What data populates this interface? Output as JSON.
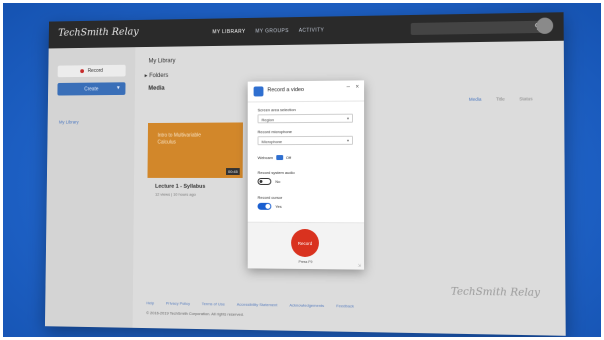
{
  "app": {
    "brand": "TechSmith Relay",
    "nav_tabs": [
      "MY LIBRARY",
      "MY GROUPS",
      "ACTIVITY"
    ],
    "search_icon": "search-icon",
    "colors": {
      "accent": "#3a6fb8",
      "record": "#d9321f",
      "thumbnail": "#d2872a",
      "topbar": "#2a2a2a"
    }
  },
  "sidebar": {
    "record_label": "Record",
    "create_label": "Create",
    "link_label": "My Library"
  },
  "main": {
    "breadcrumb": "My Library",
    "folders_label": "Folders",
    "media_label": "Media",
    "view_tabs": [
      "Media",
      "Title",
      "Status"
    ],
    "card": {
      "thumb_text": "Intro to Multivariable Calculus",
      "duration": "00:45",
      "title": "Lecture 1 - Syllabus",
      "meta": "12 views  |  10 hours ago"
    },
    "footer_links": [
      "Help",
      "Privacy Policy",
      "Terms of Use",
      "Accessibility Statement",
      "Acknowledgements",
      "Feedback"
    ],
    "footer_copy": "© 2016-2019 TechSmith Corporation. All rights reserved.",
    "watermark": "TechSmith Relay"
  },
  "dialog": {
    "title": "Record a video",
    "minimize_glyph": "–",
    "close_glyph": "×",
    "screen_label": "Screen area selection",
    "screen_value": "Region",
    "mic_label": "Record microphone",
    "mic_value": "Microphone",
    "webcam_label": "Webcam",
    "webcam_value": "Off",
    "system_audio_label": "Record system audio",
    "system_audio_state": "No",
    "system_audio_on": false,
    "cursor_label": "Record cursor",
    "cursor_state": "Yes",
    "cursor_on": true,
    "record_button": "Record",
    "record_caption": "Press F9"
  }
}
